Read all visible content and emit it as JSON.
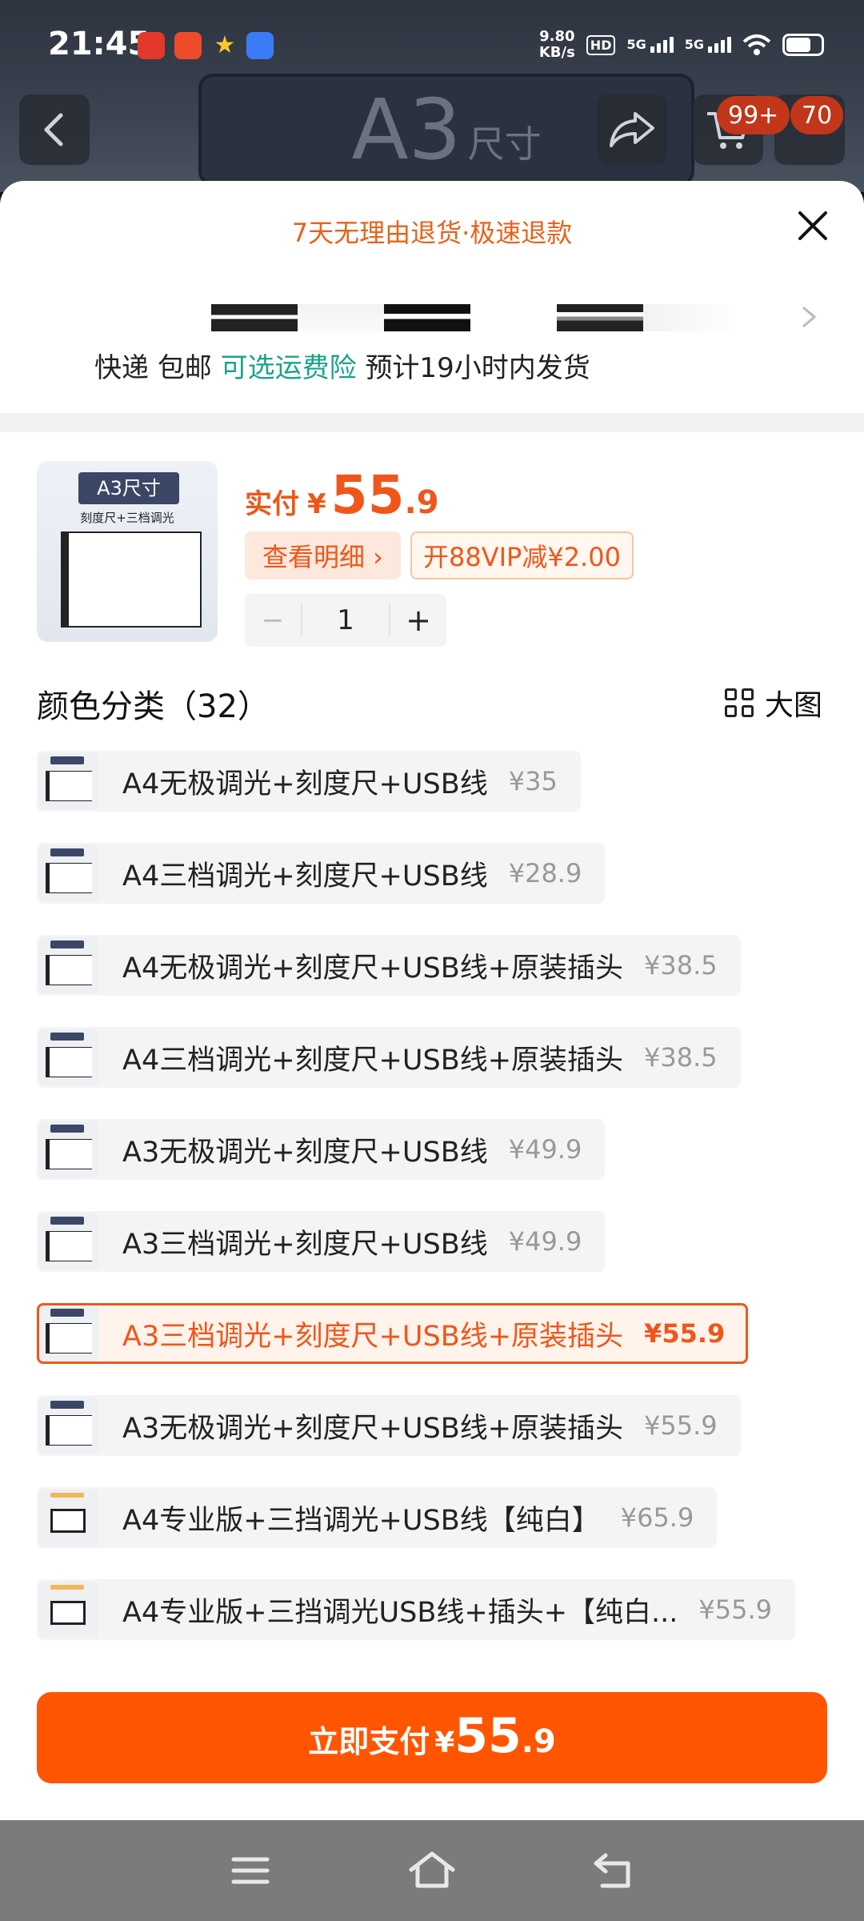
{
  "status_bar": {
    "time": "21:45",
    "net_speed_value": "9.80",
    "net_speed_unit": "KB/s",
    "hd_label": "HD",
    "sim1_label": "5G",
    "sim2_label": "5G"
  },
  "backdrop": {
    "banner_big": "A3",
    "banner_small": "尺寸",
    "cart_badge": "99+",
    "msg_badge": "70"
  },
  "sheet": {
    "promise": "7天无理由退货·极速退款",
    "shipping": {
      "express": "快递",
      "free": "包邮",
      "insurance": "可选运费险",
      "estimate": "预计19小时内发货"
    }
  },
  "summary": {
    "thumb_tag": "A3尺寸",
    "thumb_caption": "刻度尺+三档调光",
    "price_label": "实付",
    "price_currency": "¥",
    "price_int": "55",
    "price_dec": ".9",
    "detail_label": "查看明细 ›",
    "vip_label": "开88VIP减¥2.00",
    "minus": "−",
    "quantity": "1",
    "plus": "+"
  },
  "options_header": {
    "title": "颜色分类（32）",
    "view_label": "大图"
  },
  "options": [
    {
      "label": "A4无极调光+刻度尺+USB线",
      "price": "¥35",
      "selected": false
    },
    {
      "label": "A4三档调光+刻度尺+USB线",
      "price": "¥28.9",
      "selected": false
    },
    {
      "label": "A4无极调光+刻度尺+USB线+原装插头",
      "price": "¥38.5",
      "selected": false
    },
    {
      "label": "A4三档调光+刻度尺+USB线+原装插头",
      "price": "¥38.5",
      "selected": false
    },
    {
      "label": "A3无极调光+刻度尺+USB线",
      "price": "¥49.9",
      "selected": false
    },
    {
      "label": "A3三档调光+刻度尺+USB线",
      "price": "¥49.9",
      "selected": false
    },
    {
      "label": "A3三档调光+刻度尺+USB线+原装插头",
      "price": "¥55.9",
      "selected": true
    },
    {
      "label": "A3无极调光+刻度尺+USB线+原装插头",
      "price": "¥55.9",
      "selected": false
    },
    {
      "label": "A4专业版+三挡调光+USB线【纯白】",
      "price": "¥65.9",
      "selected": false
    },
    {
      "label": "A4专业版+三挡调光USB线+插头+【纯白...",
      "price": "¥55.9",
      "selected": false
    }
  ],
  "pay_button": {
    "label": "立即支付",
    "currency": "¥",
    "int": "55",
    "dec": ".9"
  },
  "colors": {
    "accent": "#ff5500",
    "price_orange": "#f0561a",
    "insurance_green": "#1aa38a"
  }
}
